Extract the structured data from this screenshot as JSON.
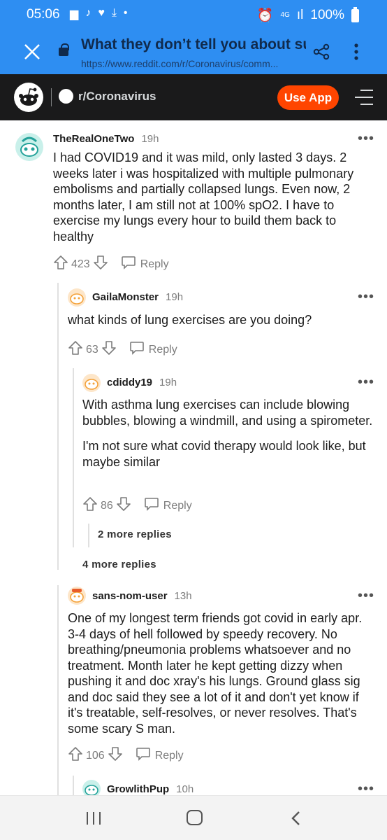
{
  "status_bar": {
    "time": "05:06",
    "network": "4G",
    "battery": "100%"
  },
  "browser": {
    "page_title": "What they don’t tell you about sur...",
    "url": "https://www.reddit.com/r/Coronavirus/comm..."
  },
  "reddit_header": {
    "subreddit": "r/Coronavirus",
    "use_app_label": "Use App"
  },
  "comments": [
    {
      "user": "TheRealOneTwo",
      "age": "19h",
      "body": [
        "I had COVID19 and it was mild, only lasted 3 days. 2 weeks later i was hospitalized with multiple pulmonary embolisms and partially collapsed lungs. Even now, 2 months later, I am still not at 100% spO2. I have to exercise my lungs every hour to build them back to healthy"
      ],
      "score": "423",
      "reply_label": "Reply"
    },
    {
      "user": "GailaMonster",
      "age": "19h",
      "body": [
        "what kinds of lung exercises are you doing?"
      ],
      "score": "63",
      "reply_label": "Reply"
    },
    {
      "user": "cdiddy19",
      "age": "19h",
      "body": [
        "With asthma lung exercises can include blowing bubbles, blowing a windmill, and using a spirometer.",
        "I'm not sure what covid therapy would look like, but maybe similar"
      ],
      "score": "86",
      "reply_label": "Reply"
    },
    {
      "user": "sans-nom-user",
      "age": "13h",
      "body": [
        "One of my longest term friends got covid in early apr. 3-4 days of hell followed by speedy recovery. No breathing/pneumonia problems whatsoever and no treatment. Month later he kept getting dizzy when pushing it and doc xray's his lungs. Ground glass sig and doc said they see a lot of it and don't yet know if it's treatable, self-resolves, or never resolves. That's some scary S man."
      ],
      "score": "106",
      "reply_label": "Reply"
    },
    {
      "user": "GrowlithPup",
      "age": "10h"
    }
  ],
  "more_replies": [
    {
      "label": "2 more replies"
    },
    {
      "label": "4 more replies"
    }
  ],
  "icons": [
    "close-icon",
    "lock-icon",
    "share-icon",
    "more-vert-icon",
    "reddit-logo-icon",
    "menu-icon",
    "upvote-icon",
    "downvote-icon",
    "reply-icon",
    "more-horizontal-icon"
  ],
  "colors": {
    "browser_bar": "#2e8ef2",
    "reddit_header": "#1a1a1b",
    "use_app": "#ff4500"
  }
}
